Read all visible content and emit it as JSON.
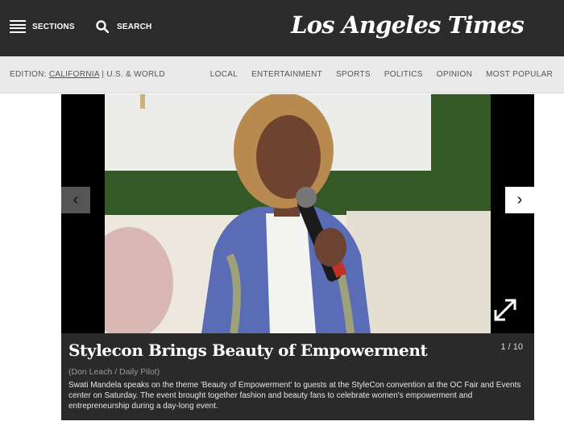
{
  "header": {
    "sections_label": "SECTIONS",
    "search_label": "SEARCH",
    "logo_text": "Los Angeles Times"
  },
  "subnav": {
    "edition_prefix": "EDITION:",
    "edition_current": "CALIFORNIA",
    "edition_separator": "|",
    "edition_alt": "U.S. & WORLD",
    "links": [
      "LOCAL",
      "ENTERTAINMENT",
      "SPORTS",
      "POLITICS",
      "OPINION",
      "MOST POPULAR"
    ]
  },
  "gallery": {
    "prev_icon": "chevron-left-icon",
    "next_icon": "chevron-right-icon",
    "expand_icon": "expand-icon",
    "headline": "Stylecon Brings Beauty of Empowerment",
    "counter": "1 / 10",
    "credit": "(Don Leach / Daily Pilot)",
    "description": "Swati Mandela speaks on the theme 'Beauty of Empowerment' to guests at the StyleCon convention at the OC Fair and Events center on Saturday. The event brought together fashion and beauty fans to celebrate women's empowerment and entrepreneurship during a day-long event."
  },
  "colors": {
    "header_bg": "#2b2b2b",
    "subnav_bg": "#e9e9e9",
    "caption_bg": "#2a2a2a"
  }
}
